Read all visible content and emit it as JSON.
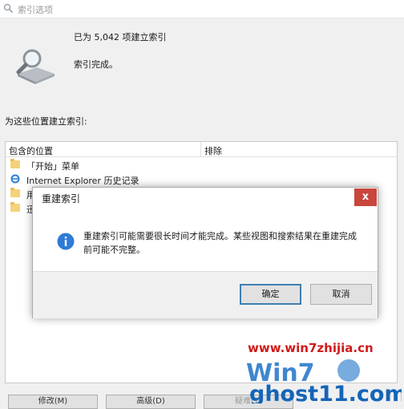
{
  "window": {
    "title": "索引选项"
  },
  "status": {
    "count_text": "已为 5,042 项建立索引",
    "message": "索引完成。"
  },
  "locations": {
    "section_label": "为这些位置建立索引:",
    "columns": {
      "included": "包含的位置",
      "excluded": "排除"
    },
    "rows": [
      {
        "icon": "folder-icon",
        "label": "「开始」菜单"
      },
      {
        "icon": "ie-icon",
        "label": "Internet Explorer 历史记录"
      },
      {
        "icon": "folder-icon",
        "label": "用"
      },
      {
        "icon": "folder-icon",
        "label": "迅"
      }
    ]
  },
  "bottom_buttons": [
    "修改(M)",
    "高级(D)",
    "疑难(T)"
  ],
  "dialog": {
    "title": "重建索引",
    "close_label": "x",
    "icon": "info-icon",
    "message": "重建索引可能需要很长时间才能完成。某些视图和搜索结果在重建完成前可能不完整。",
    "ok_label": "确定",
    "cancel_label": "取消"
  },
  "watermark": {
    "url": "www.win7zhijia.cn",
    "logo_text": "ghost11.com"
  },
  "colors": {
    "close_red": "#c9463d",
    "info_blue": "#2e7bd6",
    "watermark_red": "#d11a1a"
  }
}
